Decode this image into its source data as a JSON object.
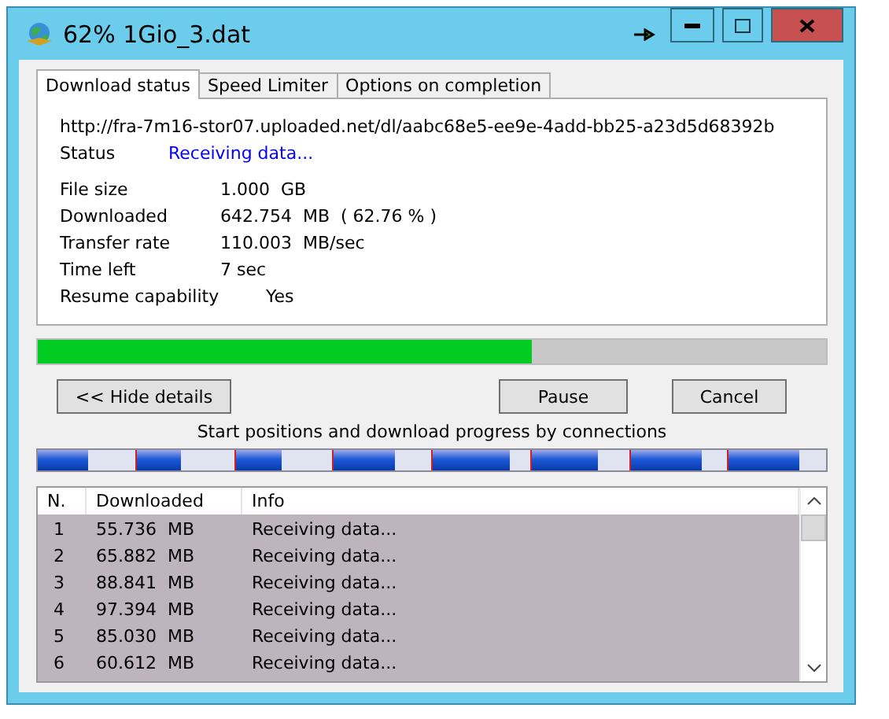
{
  "window": {
    "title": "62% 1Gio_3.dat"
  },
  "tabs": [
    {
      "label": "Download status",
      "selected": true
    },
    {
      "label": "Speed Limiter",
      "selected": false
    },
    {
      "label": "Options on completion",
      "selected": false
    }
  ],
  "status": {
    "url": "http://fra-7m16-stor07.uploaded.net/dl/aabc68e5-ee9e-4add-bb25-a23d5d68392b",
    "status_label": "Status",
    "status_value": "Receiving data...",
    "fields": [
      {
        "label": "File size",
        "value": "1.000  GB"
      },
      {
        "label": "Downloaded",
        "value": "642.754  MB  ( 62.76 % )"
      },
      {
        "label": "Transfer rate",
        "value": "110.003  MB/sec"
      },
      {
        "label": "Time left",
        "value": "7 sec"
      }
    ],
    "resume": {
      "label": "Resume capability",
      "value": "Yes"
    }
  },
  "progress": {
    "level": 0.6276
  },
  "buttons": {
    "details": "<< Hide details",
    "pause": "Pause",
    "cancel": "Cancel"
  },
  "connections_caption": "Start positions and download progress by connections",
  "connections": [
    {
      "level": 0.52
    },
    {
      "level": 0.45
    },
    {
      "level": 0.48
    },
    {
      "level": 0.62
    },
    {
      "level": 0.79
    },
    {
      "level": 0.68
    },
    {
      "level": 0.73
    },
    {
      "level": 0.73
    }
  ],
  "table": {
    "columns": [
      "N.",
      "Downloaded",
      "Info"
    ],
    "rows": [
      [
        "1",
        "55.736  MB",
        "Receiving data..."
      ],
      [
        "2",
        "65.882  MB",
        "Receiving data..."
      ],
      [
        "3",
        "88.841  MB",
        "Receiving data..."
      ],
      [
        "4",
        "97.394  MB",
        "Receiving data..."
      ],
      [
        "5",
        "85.030  MB",
        "Receiving data..."
      ],
      [
        "6",
        "60.612  MB",
        "Receiving data..."
      ]
    ]
  }
}
